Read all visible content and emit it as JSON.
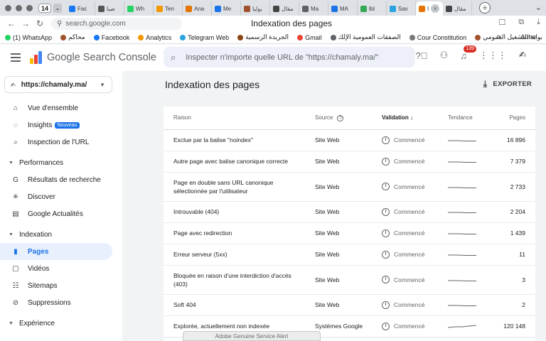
{
  "browser": {
    "tab_count": "14",
    "tabs": [
      {
        "label": "Fac",
        "color": "#1877f2"
      },
      {
        "label": "صبا",
        "color": "#555555"
      },
      {
        "label": "Wh",
        "color": "#25d366"
      },
      {
        "label": "Ten",
        "color": "#f29900"
      },
      {
        "label": "Ana",
        "color": "#e37400"
      },
      {
        "label": "Me",
        "color": "#1a73e8"
      },
      {
        "label": "يوليا",
        "color": "#a0522d"
      },
      {
        "label": "مقال",
        "color": "#444444"
      },
      {
        "label": "Ma",
        "color": "#5f6368"
      },
      {
        "label": "MA",
        "color": "#1a73e8"
      },
      {
        "label": "lbl",
        "color": "#34a853"
      },
      {
        "label": "Sav",
        "color": "#2aa3df"
      },
      {
        "label": "I",
        "color": "#e37400",
        "active": true
      },
      {
        "label": "مقال",
        "color": "#444444"
      }
    ],
    "close_glyph": "×",
    "new_tab": "+",
    "url": "search.google.com",
    "page_title": "Indexation des pages",
    "bookmarks": [
      {
        "label": "(1) WhatsApp",
        "color": "#25d366"
      },
      {
        "label": "محاكم",
        "color": "#a0522d"
      },
      {
        "label": "Facebook",
        "color": "#1877f2"
      },
      {
        "label": "Analytics",
        "color": "#f29900"
      },
      {
        "label": "Telegram Web",
        "color": "#2aa3df"
      },
      {
        "label": "الجريدة الرسمية",
        "color": "#8b4513"
      },
      {
        "label": "Gmail",
        "color": "#ea4335"
      },
      {
        "label": "الصفقات العمومية الإلك",
        "color": "#5f6368"
      },
      {
        "label": "Cour Constitution",
        "color": "#777777"
      },
      {
        "label": "بوابة التشغيل العمومي",
        "color": "#a0522d"
      },
      {
        "label": "لا يوجد ند..",
        "color": "#777777"
      }
    ],
    "bookmarks_more": "»",
    "bookmarks_other": "Autre"
  },
  "header": {
    "product_name": "Google Search Console",
    "search_placeholder": "Inspecter n'importe quelle URL de \"https://chamaly.ma/\"",
    "notification_count": "139"
  },
  "sidebar": {
    "property": "https://chamaly.ma/",
    "items_top": [
      {
        "label": "Vue d'ensemble",
        "icon": "⌂"
      },
      {
        "label": "Insights",
        "icon": "◌",
        "badge": "Nouveau"
      },
      {
        "label": "Inspection de l'URL",
        "icon": "⌕"
      }
    ],
    "section_performances": "Performances",
    "items_perf": [
      {
        "label": "Résultats de recherche",
        "icon": "G"
      },
      {
        "label": "Discover",
        "icon": "✳"
      },
      {
        "label": "Google Actualités",
        "icon": "▤"
      }
    ],
    "section_indexation": "Indexation",
    "items_index": [
      {
        "label": "Pages",
        "icon": "▮",
        "active": true
      },
      {
        "label": "Vidéos",
        "icon": "▢"
      },
      {
        "label": "Sitemaps",
        "icon": "☷"
      },
      {
        "label": "Suppressions",
        "icon": "⊘"
      }
    ],
    "section_experience": "Expérience"
  },
  "main": {
    "title": "Indexation des pages",
    "export_label": "EXPORTER",
    "columns": {
      "reason": "Raison",
      "source": "Source",
      "validation": "Validation",
      "trend": "Tendance",
      "pages": "Pages"
    },
    "rows": [
      {
        "reason": "Exclue par la balise \"noindex\"",
        "source": "Site Web",
        "validation": "Commencé",
        "pages": "16 896"
      },
      {
        "reason": "Autre page avec balise canonique correcte",
        "source": "Site Web",
        "validation": "Commencé",
        "pages": "7 379"
      },
      {
        "reason": "Page en double sans URL canonique sélectionnée par l'utilisateur",
        "source": "Site Web",
        "validation": "Commencé",
        "pages": "2 733"
      },
      {
        "reason": "Introuvable (404)",
        "source": "Site Web",
        "validation": "Commencé",
        "pages": "2 204"
      },
      {
        "reason": "Page avec redirection",
        "source": "Site Web",
        "validation": "Commencé",
        "pages": "1 439"
      },
      {
        "reason": "Erreur serveur (5xx)",
        "source": "Site Web",
        "validation": "Commencé",
        "pages": "11"
      },
      {
        "reason": "Bloquée en raison d'une interdiction d'accès (403)",
        "source": "Site Web",
        "validation": "Commencé",
        "pages": "3"
      },
      {
        "reason": "Soft 404",
        "source": "Site Web",
        "validation": "Commencé",
        "pages": "2"
      },
      {
        "reason": "Explorée, actuellement non indexée",
        "source": "Systèmes Google",
        "validation": "Commencé",
        "pages": "120 148"
      }
    ]
  },
  "overlay": {
    "alert": "Adobe Genuine Service Alert"
  }
}
